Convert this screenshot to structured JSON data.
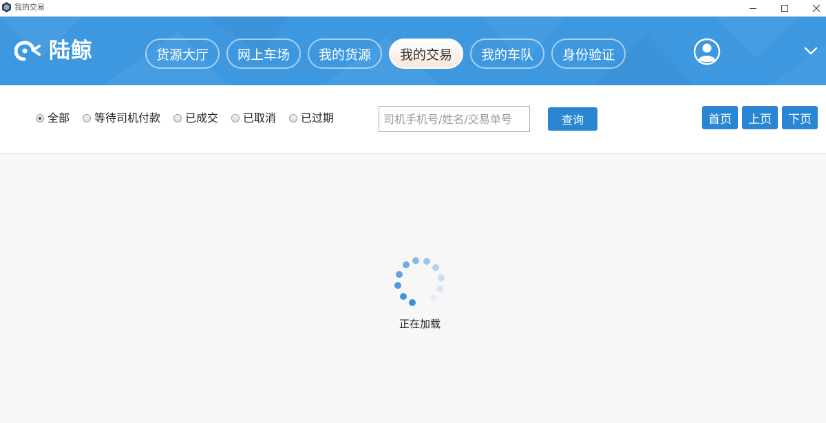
{
  "window": {
    "title": "我的交易"
  },
  "header": {
    "logo_text": "陆鲸",
    "nav": [
      {
        "label": "货源大厅",
        "active": false
      },
      {
        "label": "网上车场",
        "active": false
      },
      {
        "label": "我的货源",
        "active": false
      },
      {
        "label": "我的交易",
        "active": true
      },
      {
        "label": "我的车队",
        "active": false
      },
      {
        "label": "身份验证",
        "active": false
      }
    ]
  },
  "filters": {
    "options": [
      {
        "label": "全部",
        "checked": true
      },
      {
        "label": "等待司机付款",
        "checked": false
      },
      {
        "label": "已成交",
        "checked": false
      },
      {
        "label": "已取消",
        "checked": false
      },
      {
        "label": "已过期",
        "checked": false
      }
    ],
    "search_placeholder": "司机手机号/姓名/交易单号",
    "search_value": "",
    "query_label": "查询"
  },
  "pagination": {
    "first_label": "首页",
    "prev_label": "上页",
    "next_label": "下页"
  },
  "loading": {
    "text": "正在加载"
  },
  "colors": {
    "header_blue": "#3e98e0",
    "button_blue": "#2a86d3",
    "spinner_blue": "#3b8fdc"
  }
}
